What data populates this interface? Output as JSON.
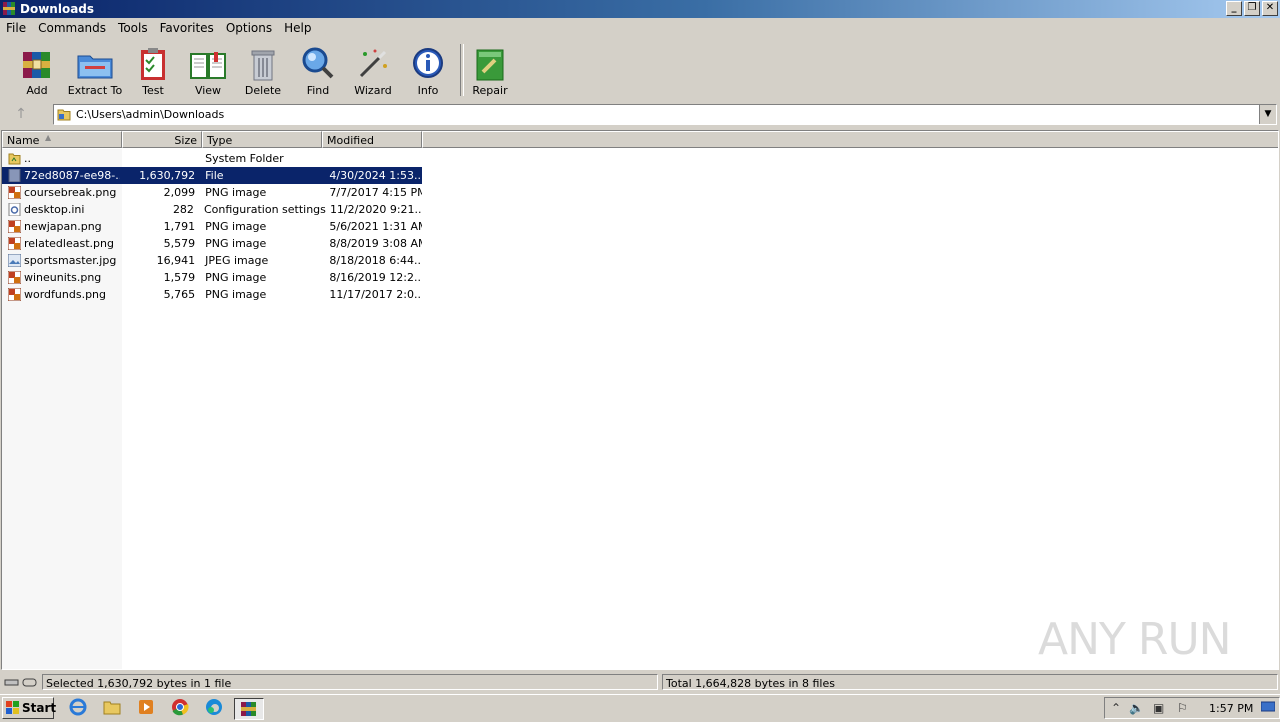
{
  "window": {
    "title": "Downloads",
    "controls": [
      "_",
      "❐",
      "✕"
    ]
  },
  "menu": [
    "File",
    "Commands",
    "Tools",
    "Favorites",
    "Options",
    "Help"
  ],
  "toolbar": {
    "add": "Add",
    "extract": "Extract To",
    "test": "Test",
    "view": "View",
    "delete": "Delete",
    "find": "Find",
    "wizard": "Wizard",
    "info": "Info",
    "repair": "Repair"
  },
  "address": {
    "path": "C:\\Users\\admin\\Downloads"
  },
  "columns": {
    "name": "Name",
    "size": "Size",
    "type": "Type",
    "modified": "Modified"
  },
  "files": [
    {
      "name": "..",
      "size": "",
      "type": "System Folder",
      "modified": "",
      "icon": "parent-folder"
    },
    {
      "name": "72ed8087-ee98-...",
      "size": "1,630,792",
      "type": "File",
      "modified": "4/30/2024 1:53...",
      "icon": "file",
      "selected": true
    },
    {
      "name": "coursebreak.png",
      "size": "2,099",
      "type": "PNG image",
      "modified": "7/7/2017 4:15 PM",
      "icon": "image"
    },
    {
      "name": "desktop.ini",
      "size": "282",
      "type": "Configuration settings",
      "modified": "11/2/2020 9:21...",
      "icon": "settings"
    },
    {
      "name": "newjapan.png",
      "size": "1,791",
      "type": "PNG image",
      "modified": "5/6/2021 1:31 AM",
      "icon": "image"
    },
    {
      "name": "relatedleast.png",
      "size": "5,579",
      "type": "PNG image",
      "modified": "8/8/2019 3:08 AM",
      "icon": "image"
    },
    {
      "name": "sportsmaster.jpg",
      "size": "16,941",
      "type": "JPEG image",
      "modified": "8/18/2018 6:44...",
      "icon": "jpeg"
    },
    {
      "name": "wineunits.png",
      "size": "1,579",
      "type": "PNG image",
      "modified": "8/16/2019 12:2...",
      "icon": "image"
    },
    {
      "name": "wordfunds.png",
      "size": "5,765",
      "type": "PNG image",
      "modified": "11/17/2017 2:0...",
      "icon": "image"
    }
  ],
  "status": {
    "left": "Selected 1,630,792 bytes in 1 file",
    "right": "Total 1,664,828 bytes in 8 files"
  },
  "watermark": "ANY RUN",
  "taskbar": {
    "start": "Start",
    "clock": "1:57 PM"
  },
  "colors": {
    "selection": "#0a246a",
    "chrome": "#d4d0c8"
  }
}
